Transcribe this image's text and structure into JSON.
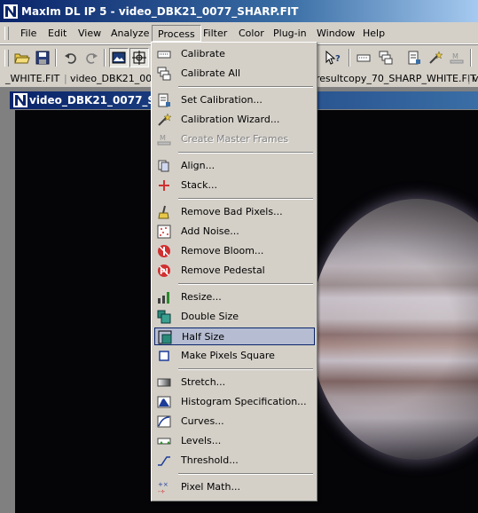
{
  "window": {
    "title": "MaxIm DL IP 5 - video_DBK21_0077_SHARP.FIT"
  },
  "menubar": {
    "items": [
      {
        "label": "File"
      },
      {
        "label": "Edit"
      },
      {
        "label": "View"
      },
      {
        "label": "Analyze"
      },
      {
        "label": "Process"
      },
      {
        "label": "Filter"
      },
      {
        "label": "Color"
      },
      {
        "label": "Plug-in"
      },
      {
        "label": "Window"
      },
      {
        "label": "Help"
      }
    ]
  },
  "tabs": {
    "left_1": "_WHITE.FIT",
    "left_2": "video_DBK21_0069",
    "right_1": "resultcopy_70_SHARP_WHITE.FIT"
  },
  "child_window": {
    "title": "video_DBK21_0077_SHA"
  },
  "process_menu": {
    "items": [
      {
        "label": "Calibrate",
        "icon": "calibrate-icon"
      },
      {
        "label": "Calibrate All",
        "icon": "calibrate-all-icon"
      },
      {
        "label": "Set Calibration...",
        "icon": "set-calibration-icon"
      },
      {
        "label": "Calibration Wizard...",
        "icon": "calibration-wizard-icon"
      },
      {
        "label": "Create Master Frames",
        "icon": "master-frames-icon",
        "disabled": true
      },
      {
        "label": "Align...",
        "icon": "align-icon"
      },
      {
        "label": "Stack...",
        "icon": "stack-icon"
      },
      {
        "label": "Remove Bad Pixels...",
        "icon": "bad-pixels-icon"
      },
      {
        "label": "Add Noise...",
        "icon": "noise-icon"
      },
      {
        "label": "Remove Bloom...",
        "icon": "bloom-icon"
      },
      {
        "label": "Remove Pedestal",
        "icon": "pedestal-icon"
      },
      {
        "label": "Resize...",
        "icon": "resize-icon"
      },
      {
        "label": "Double Size",
        "icon": "double-size-icon"
      },
      {
        "label": "Half Size",
        "icon": "half-size-icon",
        "highlighted": true
      },
      {
        "label": "Make Pixels Square",
        "icon": "pixels-square-icon"
      },
      {
        "label": "Stretch...",
        "icon": "stretch-icon"
      },
      {
        "label": "Histogram Specification...",
        "icon": "histogram-icon"
      },
      {
        "label": "Curves...",
        "icon": "curves-icon"
      },
      {
        "label": "Levels...",
        "icon": "levels-icon"
      },
      {
        "label": "Threshold...",
        "icon": "threshold-icon"
      },
      {
        "label": "Pixel Math...",
        "icon": "pixel-math-icon"
      }
    ]
  },
  "colors": {
    "title_blue": "#0a246a",
    "menu_highlight": "#b6bdd2",
    "face": "#d4d0c8"
  }
}
